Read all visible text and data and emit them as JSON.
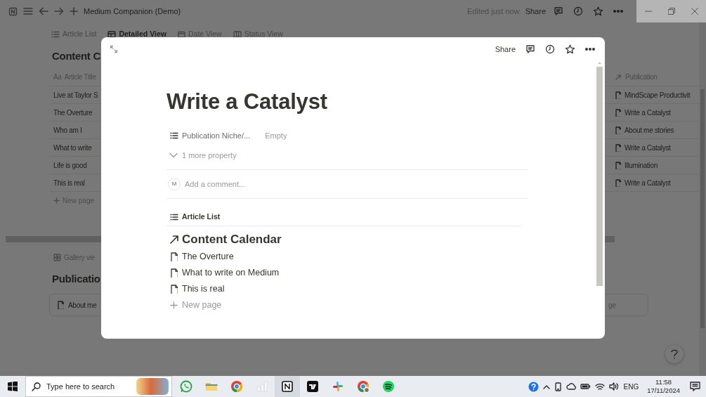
{
  "app_bar": {
    "title": "Medium Companion (Demo)",
    "edited": "Edited just now",
    "share": "Share"
  },
  "views": [
    {
      "label": "Article List",
      "kind": "list",
      "selected": false
    },
    {
      "label": "Detailed View",
      "kind": "table",
      "selected": true
    },
    {
      "label": "Date View",
      "kind": "calendar",
      "selected": false
    },
    {
      "label": "Status View",
      "kind": "board",
      "selected": false
    }
  ],
  "database": {
    "title": "Content C",
    "columns": [
      {
        "icon_text": "Aa",
        "label": "Article Title"
      },
      {
        "label": "Publication"
      }
    ],
    "rows": [
      {
        "title": "Live at Taylor S",
        "publication": "MindScape Productivit"
      },
      {
        "title": "The Overture",
        "publication": "Write a Catalyst"
      },
      {
        "title": "Who am I",
        "publication": "About me stories"
      },
      {
        "title": "What to write",
        "publication": "Write a Catalyst"
      },
      {
        "title": "Life is good",
        "publication": "Illumination"
      },
      {
        "title": "This is real",
        "publication": "Write a Catalyst"
      }
    ],
    "new_page": "New page"
  },
  "gallery": {
    "view_label": "Gallery vie",
    "title": "Publicatio",
    "cards": [
      "About me",
      "ge"
    ]
  },
  "modal": {
    "share": "Share",
    "title": "Write a Catalyst",
    "properties": [
      {
        "label": "Publication Niche/...",
        "value": "Empty"
      }
    ],
    "more_properties": "1 more property",
    "comment": {
      "avatar": "M",
      "placeholder": "Add a comment..."
    },
    "linked_view": "Article List",
    "linked_database": "Content Calendar",
    "pages": [
      "The Overture",
      "What to write on Medium",
      "This is real"
    ],
    "new_page": "New page"
  },
  "taskbar": {
    "search_placeholder": "Type here to search",
    "apps": [
      {
        "kind": "chat",
        "selected": false
      },
      {
        "kind": "folder",
        "selected": false
      },
      {
        "kind": "browser",
        "selected": false
      },
      {
        "kind": "bars",
        "selected": false
      },
      {
        "kind": "notes",
        "selected": true
      },
      {
        "kind": "chart",
        "selected": false
      },
      {
        "kind": "pinwheel",
        "selected": false
      },
      {
        "kind": "browser_profile",
        "selected": false
      },
      {
        "kind": "music",
        "selected": false
      }
    ],
    "language": "ENG",
    "time": "11:58",
    "date": "17/11/2024"
  }
}
